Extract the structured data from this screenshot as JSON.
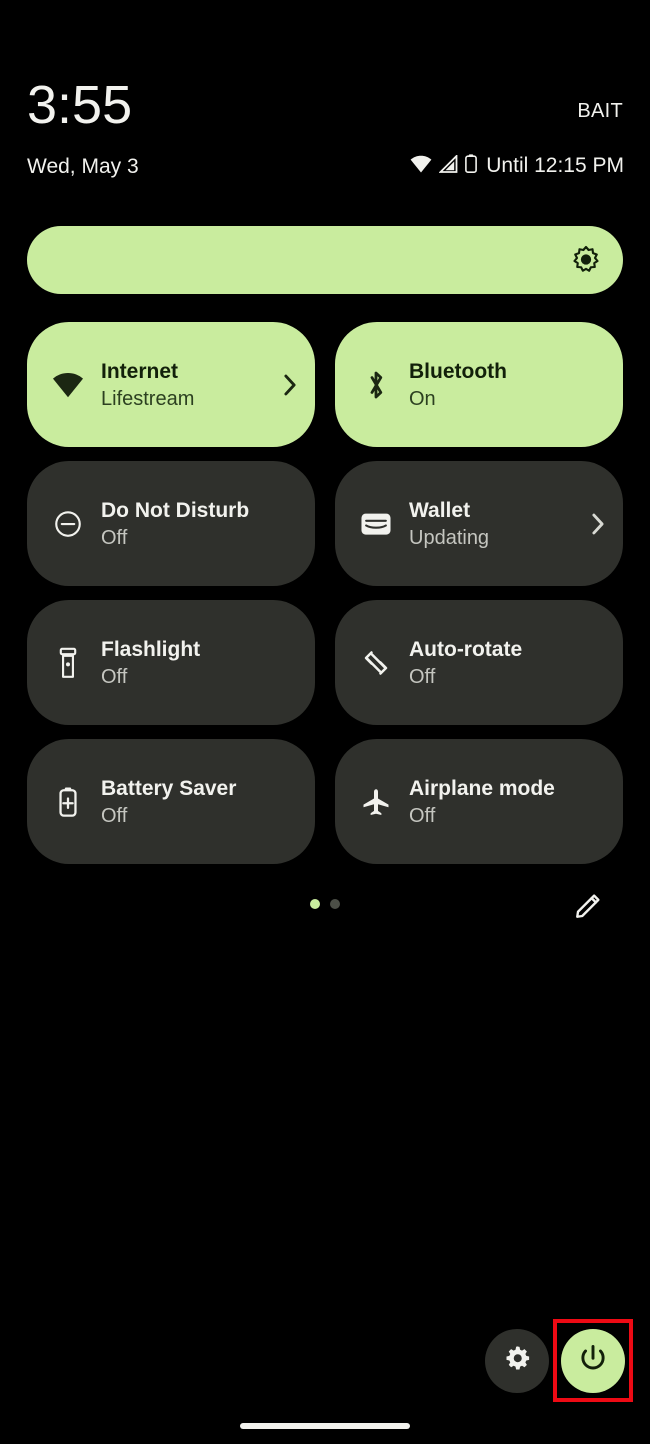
{
  "statusbar": {
    "time": "3:55",
    "carrier": "BAIT",
    "date": "Wed, May 3",
    "battery_estimate": "Until 12:15 PM",
    "icons": [
      "wifi-icon",
      "cell-signal-icon",
      "battery-icon"
    ]
  },
  "brightness": {
    "icon": "brightness-icon",
    "level_percent": 100,
    "track_color": "#c9ec9e"
  },
  "tiles": [
    {
      "id": "internet",
      "title": "Internet",
      "subtitle": "Lifestream",
      "state": "on",
      "icon": "wifi-icon",
      "has_chevron": true
    },
    {
      "id": "bluetooth",
      "title": "Bluetooth",
      "subtitle": "On",
      "state": "on",
      "icon": "bluetooth-icon",
      "has_chevron": false
    },
    {
      "id": "do-not-disturb",
      "title": "Do Not Disturb",
      "subtitle": "Off",
      "state": "off",
      "icon": "do-not-disturb-icon",
      "has_chevron": false
    },
    {
      "id": "wallet",
      "title": "Wallet",
      "subtitle": "Updating",
      "state": "off",
      "icon": "wallet-icon",
      "has_chevron": true
    },
    {
      "id": "flashlight",
      "title": "Flashlight",
      "subtitle": "Off",
      "state": "off",
      "icon": "flashlight-icon",
      "has_chevron": false
    },
    {
      "id": "auto-rotate",
      "title": "Auto-rotate",
      "subtitle": "Off",
      "state": "off",
      "icon": "auto-rotate-icon",
      "has_chevron": false
    },
    {
      "id": "battery-saver",
      "title": "Battery Saver",
      "subtitle": "Off",
      "state": "off",
      "icon": "battery-saver-icon",
      "has_chevron": false
    },
    {
      "id": "airplane-mode",
      "title": "Airplane mode",
      "subtitle": "Off",
      "state": "off",
      "icon": "airplane-icon",
      "has_chevron": false
    }
  ],
  "pager": {
    "page_count": 2,
    "current_page": 1,
    "edit_icon": "pencil-icon"
  },
  "footer": {
    "settings_icon": "gear-icon",
    "power_icon": "power-icon"
  },
  "annotation": {
    "highlight_target": "power-button",
    "highlight_color": "#ee0a14"
  },
  "colors": {
    "background": "#000000",
    "tile_on": "#c9ec9e",
    "tile_off": "#2f302c",
    "text_primary": "#f2f2ee",
    "text_secondary": "#c5c6c0",
    "accent": "#c9ec9e"
  }
}
